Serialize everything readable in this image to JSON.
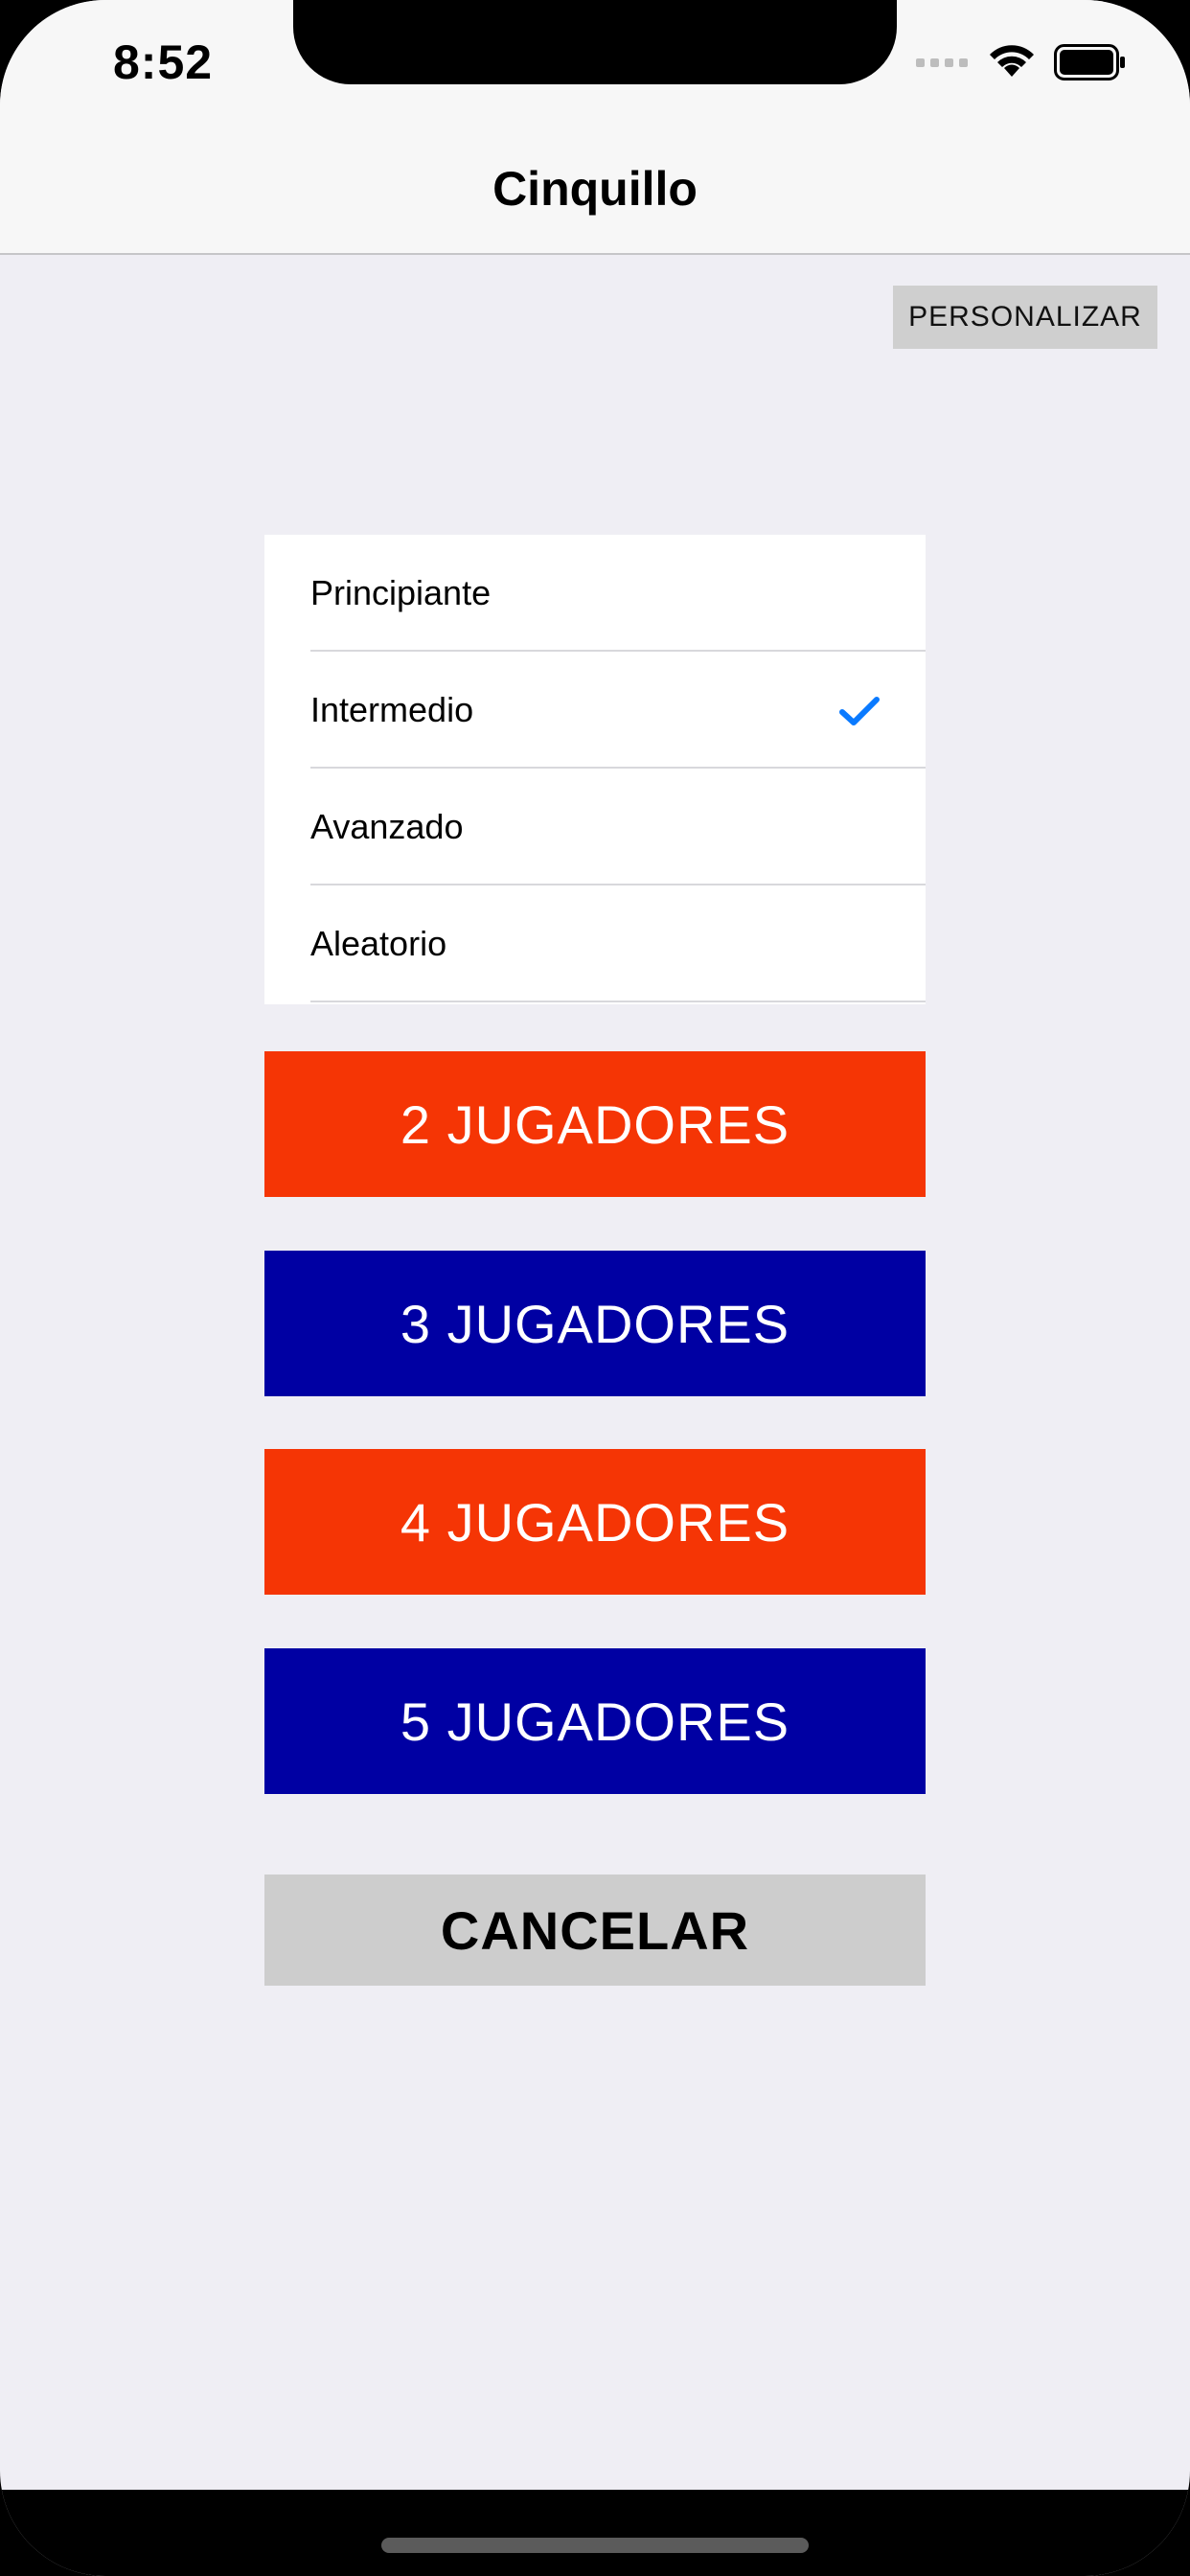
{
  "status_bar": {
    "time": "8:52",
    "icons": [
      "signal-dots-icon",
      "wifi-icon",
      "battery-icon"
    ]
  },
  "nav": {
    "title": "Cinquillo"
  },
  "toolbar": {
    "customize_label": "PERSONALIZAR"
  },
  "levels": {
    "items": [
      {
        "label": "Principiante",
        "selected": false
      },
      {
        "label": "Intermedio",
        "selected": true
      },
      {
        "label": "Avanzado",
        "selected": false
      },
      {
        "label": "Aleatorio",
        "selected": false
      }
    ]
  },
  "players": {
    "buttons": [
      {
        "label": "2 JUGADORES",
        "color": "#f53505"
      },
      {
        "label": "3 JUGADORES",
        "color": "#0000a3"
      },
      {
        "label": "4 JUGADORES",
        "color": "#f53505"
      },
      {
        "label": "5 JUGADORES",
        "color": "#0000a3"
      }
    ]
  },
  "cancel": {
    "label": "CANCELAR"
  },
  "colors": {
    "accent": "#0a7aff",
    "background": "#efeef4",
    "orange": "#f53505",
    "blue": "#0000a3"
  }
}
